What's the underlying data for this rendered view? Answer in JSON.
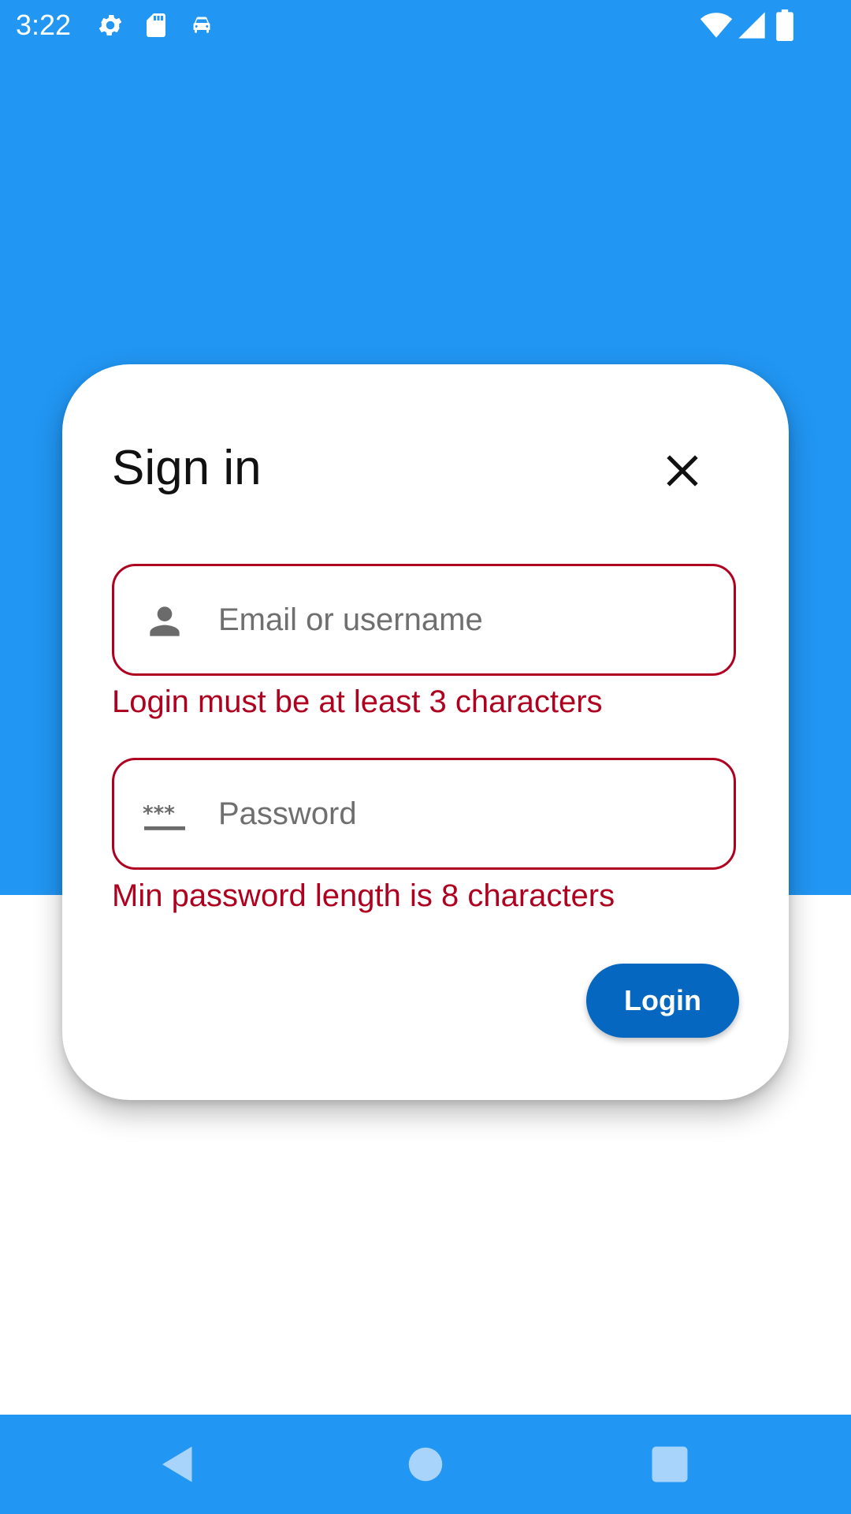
{
  "status_bar": {
    "time": "3:22",
    "left_icons": [
      "gear-icon",
      "sd-card-icon",
      "car-icon"
    ],
    "right_icons": [
      "wifi-icon",
      "cell-signal-icon",
      "battery-icon"
    ]
  },
  "dialog": {
    "title": "Sign in",
    "close_icon": "close-icon",
    "login_field": {
      "icon": "person-icon",
      "placeholder": "Email or username",
      "value": "",
      "error": "Login must be at least 3 characters"
    },
    "password_field": {
      "icon": "password-icon",
      "placeholder": "Password",
      "value": "",
      "error": "Min password length is 8 characters"
    },
    "login_button": "Login"
  },
  "nav_bar": {
    "buttons": [
      "back-icon",
      "home-icon",
      "recents-icon"
    ]
  },
  "colors": {
    "primary": "#2196f3",
    "button": "#0567c0",
    "error": "#b00020"
  }
}
